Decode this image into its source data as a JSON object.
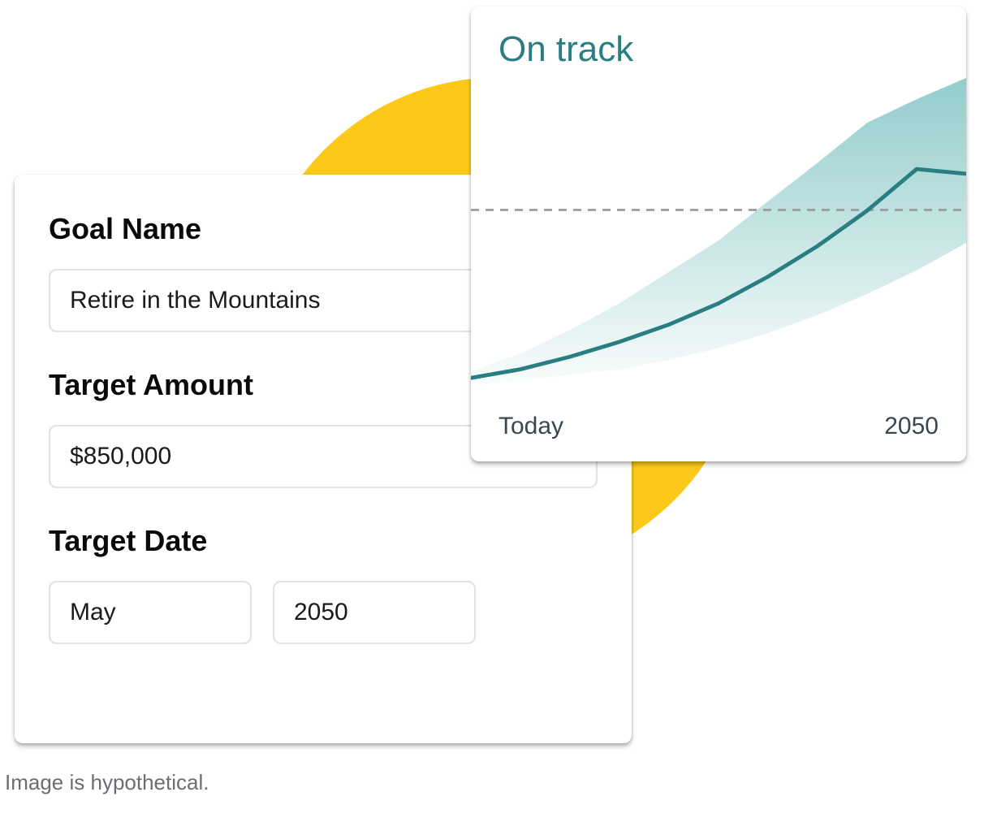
{
  "form": {
    "goal_name_label": "Goal Name",
    "goal_name_value": "Retire in the Mountains",
    "target_amount_label": "Target Amount",
    "target_amount_value": "$850,000",
    "target_date_label": "Target Date",
    "target_month_value": "May",
    "target_year_value": "2050"
  },
  "chart": {
    "title": "On track",
    "x_start_label": "Today",
    "x_end_label": "2050"
  },
  "chart_data": {
    "type": "area",
    "title": "On track",
    "xlabel": "",
    "ylabel": "",
    "x_ticks": [
      "Today",
      "2050"
    ],
    "x": [
      0,
      0.1,
      0.2,
      0.3,
      0.4,
      0.5,
      0.6,
      0.7,
      0.8,
      0.9,
      1.0
    ],
    "series": [
      {
        "name": "upper",
        "role": "band_upper",
        "values": [
          0.12,
          0.18,
          0.26,
          0.35,
          0.45,
          0.56,
          0.69,
          0.82,
          0.95,
          1.03,
          1.1
        ]
      },
      {
        "name": "median",
        "role": "line",
        "values": [
          0.1,
          0.13,
          0.17,
          0.22,
          0.28,
          0.35,
          0.44,
          0.54,
          0.66,
          0.8,
          0.78
        ]
      },
      {
        "name": "lower",
        "role": "band_lower",
        "values": [
          0.08,
          0.09,
          0.11,
          0.13,
          0.16,
          0.2,
          0.25,
          0.31,
          0.38,
          0.46,
          0.55
        ]
      }
    ],
    "target_line": 0.56,
    "ylim": [
      0,
      1.1
    ]
  },
  "colors": {
    "accent_teal": "#2a7e82",
    "band_teal": "#7fc4c2",
    "circle_yellow": "#fcc91b"
  },
  "caption": "Image is hypothetical."
}
